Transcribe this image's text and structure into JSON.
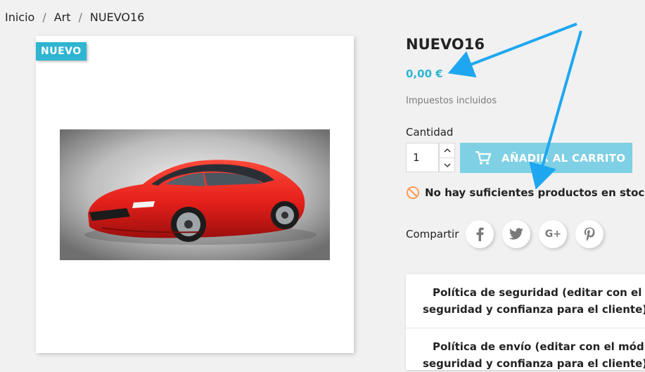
{
  "breadcrumb": {
    "home": "Inicio",
    "category": "Art",
    "current": "NUEVO16",
    "separator": "/"
  },
  "product": {
    "badge": "NUEVO",
    "title": "NUEVO16",
    "price": "0,00 €",
    "tax_note": "Impuestos incluidos",
    "quantity_label": "Cantidad",
    "quantity_value": "1",
    "add_to_cart_label": "AÑADIR AL CARRITO",
    "stock_message": "No hay suficientes productos en stock"
  },
  "share": {
    "label": "Compartir",
    "networks": [
      "facebook-icon",
      "twitter-icon",
      "google-plus-icon",
      "pinterest-icon"
    ],
    "google_plus_text": "G+"
  },
  "reassurance": {
    "items": [
      {
        "icon": "shield-check-icon",
        "line1": "Política de seguridad (editar con el mó",
        "line2": "seguridad y confianza para el cliente)"
      },
      {
        "icon": "truck-icon",
        "line1": "Política de envío (editar con el módulo",
        "line2": "seguridad y confianza para el cliente)"
      }
    ]
  },
  "colors": {
    "accent": "#2fb5d2",
    "button_disabled": "#7fd0e4",
    "stock_warning": "#ff9a52",
    "car_red": "#e8231f",
    "annotation_arrow": "#1ea7f0"
  }
}
